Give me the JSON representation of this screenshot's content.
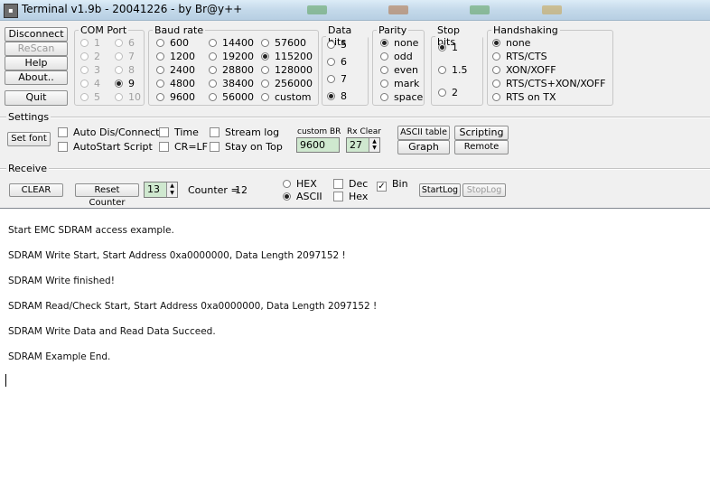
{
  "window": {
    "title": "Terminal v1.9b - 20041226 - by Br@y++"
  },
  "top_buttons": {
    "disconnect": "Disconnect",
    "rescan": "ReScan",
    "help": "Help",
    "about": "About..",
    "quit": "Quit"
  },
  "com_port": {
    "legend": "COM Port",
    "options": [
      "1",
      "2",
      "3",
      "4",
      "5",
      "6",
      "7",
      "8",
      "9",
      "10"
    ],
    "selected": "9"
  },
  "baud_rate": {
    "legend": "Baud rate",
    "options": [
      "600",
      "1200",
      "2400",
      "4800",
      "9600",
      "14400",
      "19200",
      "28800",
      "38400",
      "56000",
      "57600",
      "115200",
      "128000",
      "256000",
      "custom"
    ],
    "selected": "115200"
  },
  "data_bits": {
    "legend": "Data bits",
    "options": [
      "5",
      "6",
      "7",
      "8"
    ],
    "selected": "8"
  },
  "parity": {
    "legend": "Parity",
    "options": [
      "none",
      "odd",
      "even",
      "mark",
      "space"
    ],
    "selected": "none"
  },
  "stop_bits": {
    "legend": "Stop bits",
    "options": [
      "1",
      "1.5",
      "2"
    ],
    "selected": "1"
  },
  "handshaking": {
    "legend": "Handshaking",
    "options": [
      "none",
      "RTS/CTS",
      "XON/XOFF",
      "RTS/CTS+XON/XOFF",
      "RTS on TX"
    ],
    "selected": "none"
  },
  "settings": {
    "title": "Settings",
    "set_font": "Set font",
    "auto_dis_connect": "Auto Dis/Connect",
    "autostart_script": "AutoStart Script",
    "time": "Time",
    "cr_lf": "CR=LF",
    "stream_log": "Stream log",
    "stay_on_top": "Stay on Top",
    "custom_br_label": "custom BR",
    "custom_br_value": "9600",
    "rx_clear_label": "Rx Clear",
    "rx_clear_value": "27",
    "ascii_table": "ASCII table",
    "scripting": "Scripting",
    "graph": "Graph",
    "remote": "Remote"
  },
  "receive": {
    "title": "Receive",
    "clear": "CLEAR",
    "reset_counter": "Reset Counter",
    "counter_spin_value": "13",
    "counter_label": "Counter =",
    "counter_value": "12",
    "hex_radio": "HEX",
    "ascii_radio": "ASCII",
    "display_mode": "ASCII",
    "dec": "Dec",
    "hex_check": "Hex",
    "bin": "Bin",
    "bin_checked": true,
    "startlog": "StartLog",
    "stoplog": "StopLog"
  },
  "terminal_lines": [
    "Start EMC SDRAM access example.",
    "SDRAM Write Start, Start Address 0xa0000000, Data Length 2097152 !",
    "SDRAM Write finished!",
    "SDRAM Read/Check Start, Start Address 0xa0000000, Data Length 2097152 !",
    "SDRAM Write Data and Read Data Succeed.",
    "SDRAM Example End."
  ]
}
